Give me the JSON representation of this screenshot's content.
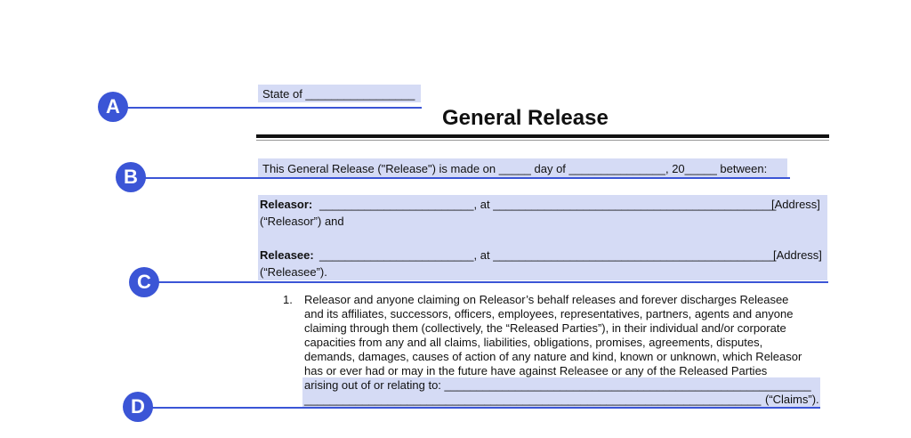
{
  "header": {
    "state_line": "State of _________________",
    "title": "General Release"
  },
  "callouts": [
    "A",
    "B",
    "C",
    "D"
  ],
  "colors": {
    "accent": "#3b55d6",
    "highlight": "#d5dbf5"
  },
  "intro": "This General Release (\"Release\") is made on _____ day of _______________, 20_____ between:",
  "parties": {
    "releasor_label": "Releasor:",
    "releasor_line": "________________________, at ____________________________________________",
    "releasor_address": "[Address]",
    "releasor_role": "(“Releasor”) and",
    "releasee_label": "Releasee:",
    "releasee_line": "________________________, at ____________________________________________",
    "releasee_address": "[Address]",
    "releasee_role": "(“Releasee”)."
  },
  "clause": {
    "number": "1.",
    "lines": [
      "Releasor and anyone claiming on Releasor’s behalf releases and forever discharges Releasee",
      "and its affiliates, successors, officers, employees, representatives, partners, agents and anyone",
      "claiming through them (collectively, the “Released Parties”), in their individual and/or corporate",
      "capacities from any and all claims, liabilities, obligations, promises, agreements, disputes,",
      "demands, damages, causes of action of any nature and kind, known or unknown, which Releasor",
      "has or ever had or may in the future have against Releasee or any of the Released Parties"
    ],
    "arising_line": "arising out of or relating to: _________________________________________________________",
    "claims_blank": "_______________________________________________________________________",
    "claims_label": "(“Claims”)."
  }
}
